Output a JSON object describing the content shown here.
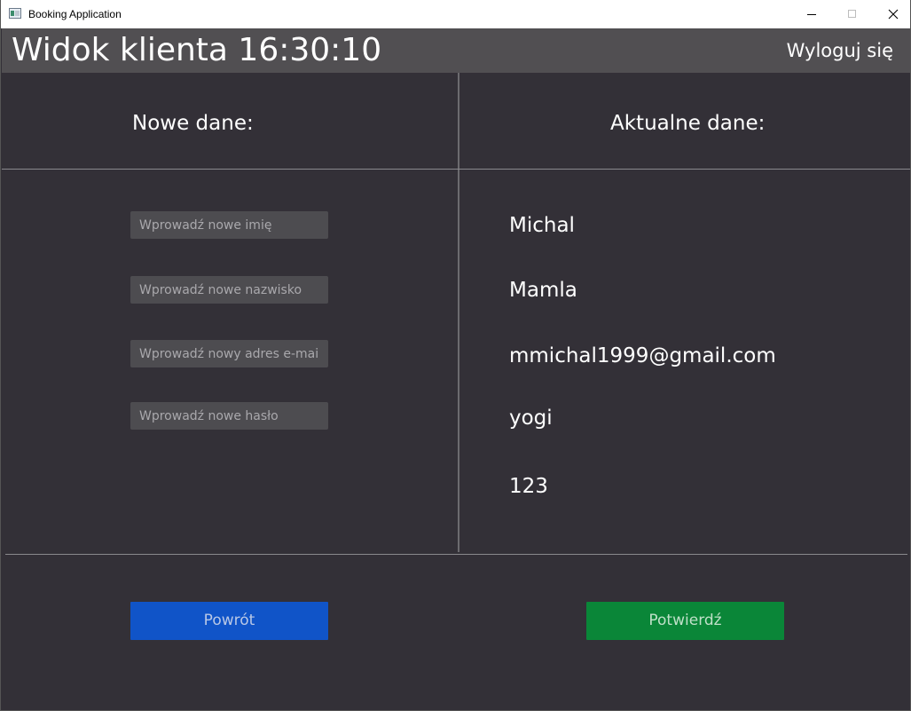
{
  "window": {
    "title": "Booking Application"
  },
  "header": {
    "title": "Widok klienta 16:30:10",
    "logout_label": "Wyloguj się"
  },
  "left_panel": {
    "heading": "Nowe dane:",
    "inputs": [
      {
        "placeholder": "Wprowadź nowe imię",
        "value": ""
      },
      {
        "placeholder": "Wprowadź nowe nazwisko",
        "value": ""
      },
      {
        "placeholder": "Wprowadź nowy adres e-mail",
        "value": ""
      },
      {
        "placeholder": "Wprowadź nowe hasło",
        "value": ""
      }
    ]
  },
  "right_panel": {
    "heading": "Aktualne dane:",
    "values": [
      "Michal",
      "Mamla",
      "mmichal1999@gmail.com",
      "yogi",
      "123"
    ]
  },
  "buttons": {
    "back_label": "Powrót",
    "confirm_label": "Potwierdź"
  },
  "colors": {
    "background": "#333037",
    "header": "#514f52",
    "back_button": "#1054c8",
    "confirm_button": "#0a8638"
  },
  "icons": [
    "app-window-icon",
    "minimize-icon",
    "maximize-icon",
    "close-icon"
  ]
}
